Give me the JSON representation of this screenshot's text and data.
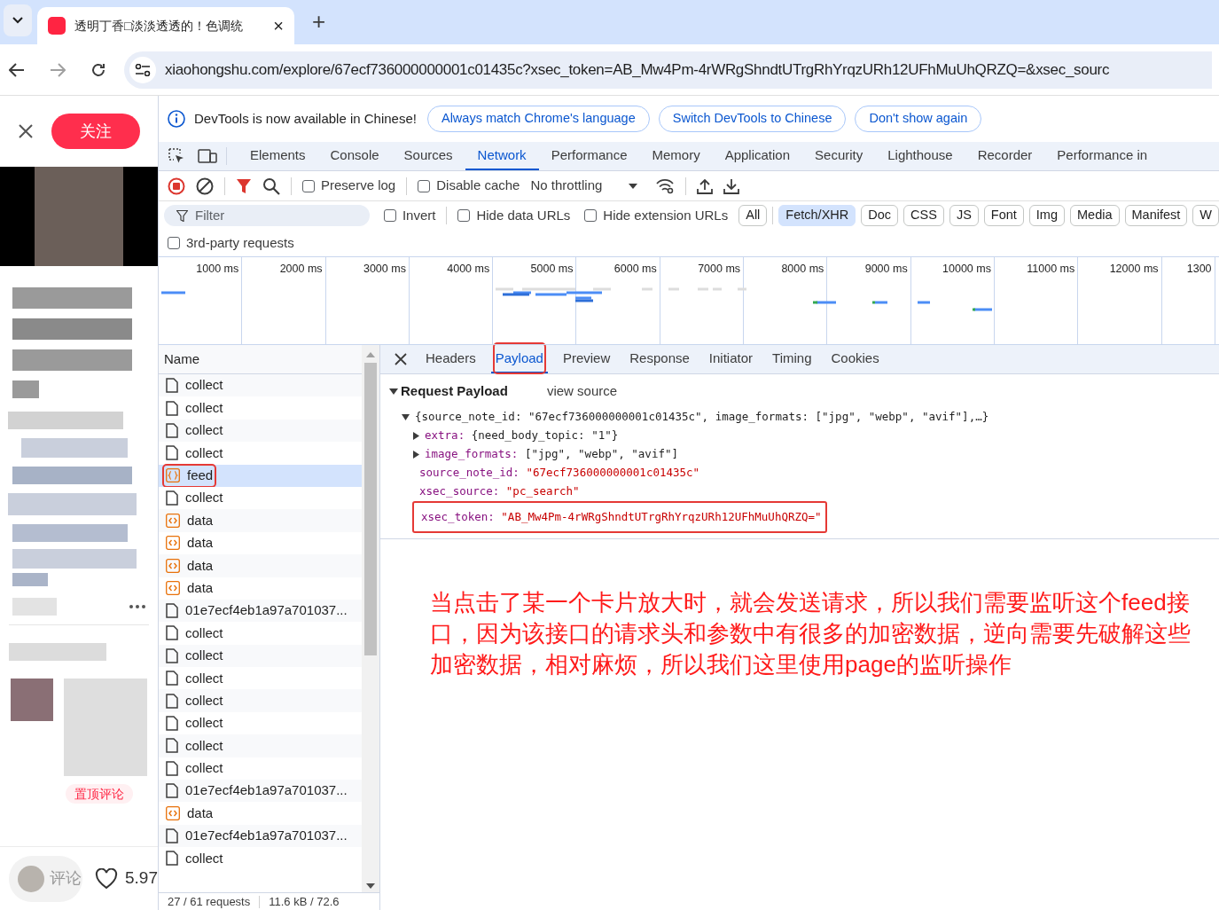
{
  "browser": {
    "tab": {
      "title": "透明丁香□淡淡透透的！色调统",
      "close": "×"
    },
    "new_tab": "+",
    "url": "xiaohongshu.com/explore/67ecf736000000001c01435c?xsec_token=AB_Mw4Pm-4rWRgShndtUTrgRhYrqzURh12UFhMuUhQRZQ=&xsec_sourc"
  },
  "page": {
    "follow_button": "关注",
    "pinned_badge": "置顶评论",
    "comment_field": "评论",
    "likes": "5.97"
  },
  "devtools": {
    "infobar": {
      "message": "DevTools is now available in Chinese!",
      "buttons": [
        "Always match Chrome's language",
        "Switch DevTools to Chinese",
        "Don't show again"
      ]
    },
    "tabs": [
      {
        "label": "Elements",
        "selected": false
      },
      {
        "label": "Console",
        "selected": false
      },
      {
        "label": "Sources",
        "selected": false
      },
      {
        "label": "Network",
        "selected": true
      },
      {
        "label": "Performance",
        "selected": false
      },
      {
        "label": "Memory",
        "selected": false
      },
      {
        "label": "Application",
        "selected": false
      },
      {
        "label": "Security",
        "selected": false
      },
      {
        "label": "Lighthouse",
        "selected": false
      },
      {
        "label": "Recorder",
        "selected": false
      },
      {
        "label": "Performance in",
        "selected": false
      }
    ],
    "toolbar": {
      "preserve_log": {
        "label": "Preserve log",
        "checked": false
      },
      "disable_cache": {
        "label": "Disable cache",
        "checked": false
      },
      "throttling": "No throttling"
    },
    "filter": {
      "placeholder": "Filter",
      "invert": {
        "label": "Invert",
        "checked": false
      },
      "hide_data_urls": {
        "label": "Hide data URLs",
        "checked": false
      },
      "hide_extension_urls": {
        "label": "Hide extension URLs",
        "checked": false
      },
      "types": [
        {
          "label": "All",
          "selected": false
        },
        {
          "label": "Fetch/XHR",
          "selected": true
        },
        {
          "label": "Doc",
          "selected": false
        },
        {
          "label": "CSS",
          "selected": false
        },
        {
          "label": "JS",
          "selected": false
        },
        {
          "label": "Font",
          "selected": false
        },
        {
          "label": "Img",
          "selected": false
        },
        {
          "label": "Media",
          "selected": false
        },
        {
          "label": "Manifest",
          "selected": false
        },
        {
          "label": "W",
          "selected": false
        }
      ],
      "third_party": {
        "label": "3rd-party requests",
        "checked": false
      }
    },
    "timeline_ticks": [
      "1000 ms",
      "2000 ms",
      "3000 ms",
      "4000 ms",
      "5000 ms",
      "6000 ms",
      "7000 ms",
      "8000 ms",
      "9000 ms",
      "10000 ms",
      "11000 ms",
      "12000 ms",
      "1300"
    ],
    "requests": {
      "column": "Name",
      "rows": [
        {
          "name": "collect",
          "kind": "doc",
          "selected": false
        },
        {
          "name": "collect",
          "kind": "doc",
          "selected": false
        },
        {
          "name": "collect",
          "kind": "doc",
          "selected": false
        },
        {
          "name": "collect",
          "kind": "doc",
          "selected": false
        },
        {
          "name": "feed",
          "kind": "fetch",
          "selected": true
        },
        {
          "name": "collect",
          "kind": "doc",
          "selected": false
        },
        {
          "name": "data",
          "kind": "data",
          "selected": false
        },
        {
          "name": "data",
          "kind": "data",
          "selected": false
        },
        {
          "name": "data",
          "kind": "data",
          "selected": false
        },
        {
          "name": "data",
          "kind": "data",
          "selected": false
        },
        {
          "name": "01e7ecf4eb1a97a701037...",
          "kind": "doc",
          "selected": false
        },
        {
          "name": "collect",
          "kind": "doc",
          "selected": false
        },
        {
          "name": "collect",
          "kind": "doc",
          "selected": false
        },
        {
          "name": "collect",
          "kind": "doc",
          "selected": false
        },
        {
          "name": "collect",
          "kind": "doc",
          "selected": false
        },
        {
          "name": "collect",
          "kind": "doc",
          "selected": false
        },
        {
          "name": "collect",
          "kind": "doc",
          "selected": false
        },
        {
          "name": "collect",
          "kind": "doc",
          "selected": false
        },
        {
          "name": "01e7ecf4eb1a97a701037...",
          "kind": "doc",
          "selected": false
        },
        {
          "name": "data",
          "kind": "data",
          "selected": false
        },
        {
          "name": "01e7ecf4eb1a97a701037...",
          "kind": "doc",
          "selected": false
        },
        {
          "name": "collect",
          "kind": "doc",
          "selected": false
        }
      ],
      "status": [
        "27 / 61 requests",
        "11.6 kB / 72.6"
      ]
    },
    "detail_tabs": [
      {
        "label": "Headers",
        "selected": false
      },
      {
        "label": "Payload",
        "selected": true
      },
      {
        "label": "Preview",
        "selected": false
      },
      {
        "label": "Response",
        "selected": false
      },
      {
        "label": "Initiator",
        "selected": false
      },
      {
        "label": "Timing",
        "selected": false
      },
      {
        "label": "Cookies",
        "selected": false
      }
    ],
    "payload": {
      "title": "Request Payload",
      "view_source": "view source",
      "summary": "{source_note_id: \"67ecf736000000001c01435c\", image_formats: [\"jpg\", \"webp\", \"avif\"],…}",
      "entries": [
        {
          "key": "extra:",
          "value": "{need_body_topic: \"1\"}",
          "kind": "object",
          "highlighted": false
        },
        {
          "key": "image_formats:",
          "value": "[\"jpg\", \"webp\", \"avif\"]",
          "kind": "object",
          "highlighted": false
        },
        {
          "key": "source_note_id:",
          "value": "\"67ecf736000000001c01435c\"",
          "kind": "string",
          "highlighted": false
        },
        {
          "key": "xsec_source:",
          "value": "\"pc_search\"",
          "kind": "string",
          "highlighted": false
        },
        {
          "key": "xsec_token:",
          "value": "\"AB_Mw4Pm-4rWRgShndtUTrgRhYrqzURh12UFhMuUhQRZQ=\"",
          "kind": "string",
          "highlighted": true
        }
      ]
    },
    "annotation": "当点击了某一个卡片放大时，就会发送请求，所以我们需要监听这个feed接口，因为该接口的请求头和参数中有很多的加密数据，逆向需要先破解这些加密数据，相对麻烦，所以我们这里使用page的监听操作"
  }
}
